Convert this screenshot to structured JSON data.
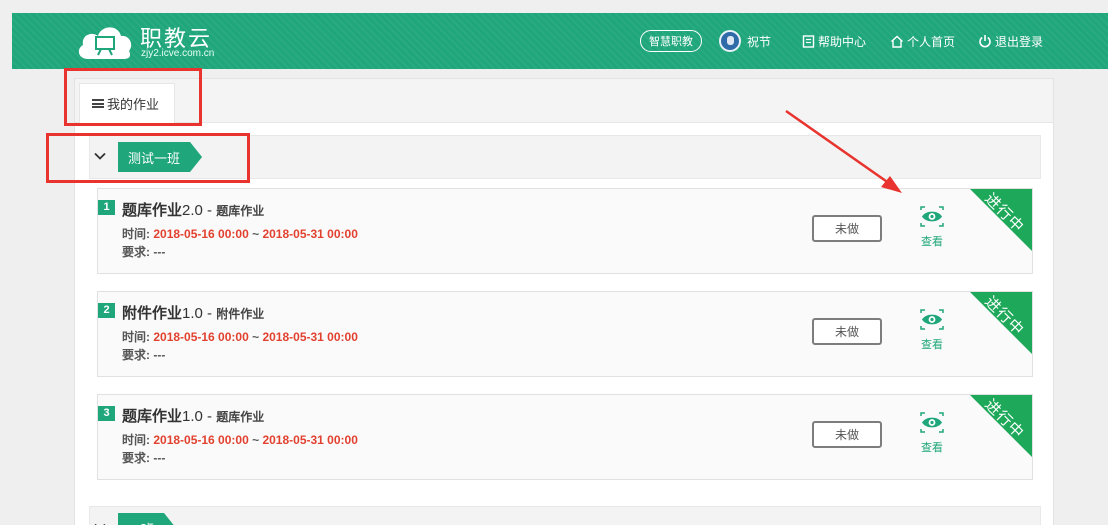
{
  "header": {
    "brand_title": "职教云",
    "brand_sub": "zjy2.icve.com.cn",
    "pill_label": "智慧职教",
    "user_name": "祝节",
    "help_label": "帮助中心",
    "home_label": "个人首页",
    "logout_label": "退出登录",
    "accent": "#1fa67a"
  },
  "tabs": [
    {
      "label": "我的作业",
      "icon": "list-icon"
    }
  ],
  "classes": [
    {
      "label": "测试一班",
      "expanded": true
    },
    {
      "label": "一班",
      "expanded": false
    }
  ],
  "assignments": [
    {
      "index": "1",
      "name": "题库作业",
      "version": "2.0",
      "separator": " - ",
      "type": "题库作业",
      "time_label": "时间:",
      "start": "2018-05-16 00:00",
      "range_sep": " ~ ",
      "end": "2018-05-31 00:00",
      "req_label": "要求:",
      "requirement": "---",
      "status": "未做",
      "view_label": "查看",
      "badge": "进行中"
    },
    {
      "index": "2",
      "name": "附件作业",
      "version": "1.0",
      "separator": " - ",
      "type": "附件作业",
      "time_label": "时间:",
      "start": "2018-05-16 00:00",
      "range_sep": " ~ ",
      "end": "2018-05-31 00:00",
      "req_label": "要求:",
      "requirement": "---",
      "status": "未做",
      "view_label": "查看",
      "badge": "进行中"
    },
    {
      "index": "3",
      "name": "题库作业",
      "version": "1.0",
      "separator": " - ",
      "type": "题库作业",
      "time_label": "时间:",
      "start": "2018-05-16 00:00",
      "range_sep": " ~ ",
      "end": "2018-05-31 00:00",
      "req_label": "要求:",
      "requirement": "---",
      "status": "未做",
      "view_label": "查看",
      "badge": "进行中"
    }
  ],
  "colors": {
    "time_red": "#e2412f",
    "badge_green": "#1ea85a",
    "annotation_red": "#e8332e"
  }
}
